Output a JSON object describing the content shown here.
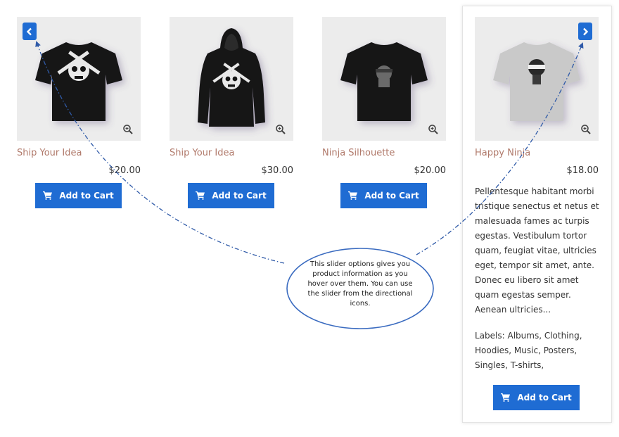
{
  "products": [
    {
      "title": "Ship Your Idea",
      "price": "$20.00",
      "button_label": "Add to Cart",
      "image": "black-tshirt-skull",
      "shirt_color": "#121212"
    },
    {
      "title": "Ship Your Idea",
      "price": "$30.00",
      "button_label": "Add to Cart",
      "image": "black-hoodie-skull",
      "shirt_color": "#141414"
    },
    {
      "title": "Ninja Silhouette",
      "price": "$20.00",
      "button_label": "Add to Cart",
      "image": "black-tshirt-ninja",
      "shirt_color": "#121212"
    },
    {
      "title": "Happy Ninja",
      "price": "$18.00",
      "button_label": "Add to Cart",
      "image": "grey-tshirt-ninja",
      "shirt_color": "#c9c9c9"
    }
  ],
  "hover_card": {
    "description": "Pellentesque habitant morbi tristique senectus et netus et malesuada fames ac turpis egestas. Vestibulum tortor quam, feugiat vitae, ultricies eget, tempor sit amet, ante. Donec eu libero sit amet quam egestas semper. Aenean ultricies...",
    "labels_text": "Labels: Albums, Clothing, Hoodies, Music, Posters, Singles, T-shirts,"
  },
  "callout": {
    "text": "This slider options gives you product information as you hover over them. You can use the slider from the directional icons."
  },
  "icons": {
    "prev": "chevron-left-icon",
    "next": "chevron-right-icon",
    "zoom": "zoom-in-icon",
    "cart": "cart-icon"
  },
  "colors": {
    "accent": "#1f6cd3",
    "title": "#b0796a",
    "text": "#333333"
  }
}
